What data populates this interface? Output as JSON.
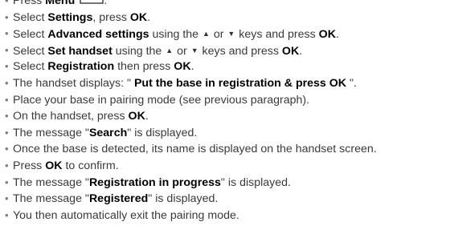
{
  "steps": [
    {
      "segments": [
        {
          "t": "Press ",
          "b": false
        },
        {
          "t": "Menu",
          "b": true
        }
      ],
      "menu_icon": true,
      "tail": "."
    },
    {
      "segments": [
        {
          "t": "Select ",
          "b": false
        },
        {
          "t": "Settings",
          "b": true
        },
        {
          "t": ", press ",
          "b": false
        },
        {
          "t": "OK",
          "b": true
        },
        {
          "t": ".",
          "b": false
        }
      ]
    },
    {
      "segments": [
        {
          "t": "Select ",
          "b": false
        },
        {
          "t": "Advanced settings",
          "b": true
        },
        {
          "t": " using the ",
          "b": false
        },
        {
          "icon": "up"
        },
        {
          "t": " or ",
          "b": false
        },
        {
          "icon": "down"
        },
        {
          "t": " keys and press ",
          "b": false
        },
        {
          "t": "OK",
          "b": true
        },
        {
          "t": ".",
          "b": false
        }
      ]
    },
    {
      "segments": [
        {
          "t": "Select ",
          "b": false
        },
        {
          "t": "Set handset",
          "b": true
        },
        {
          "t": " using the ",
          "b": false
        },
        {
          "icon": "up"
        },
        {
          "t": " or ",
          "b": false
        },
        {
          "icon": "down"
        },
        {
          "t": " keys and press ",
          "b": false
        },
        {
          "t": "OK",
          "b": true
        },
        {
          "t": ".",
          "b": false
        }
      ]
    },
    {
      "segments": [
        {
          "t": "Select ",
          "b": false
        },
        {
          "t": "Registration",
          "b": true
        },
        {
          "t": " then press ",
          "b": false
        },
        {
          "t": "OK",
          "b": true
        },
        {
          "t": ".",
          "b": false
        }
      ]
    },
    {
      "segments": [
        {
          "t": "The handset displays: \" ",
          "b": false
        },
        {
          "t": "Put the base in registration & press OK",
          "b": true
        },
        {
          "t": " \".",
          "b": false
        }
      ]
    },
    {
      "segments": [
        {
          "t": "Place your base in pairing mode (see previous paragraph).",
          "b": false
        }
      ]
    },
    {
      "segments": [
        {
          "t": "On the handset, press ",
          "b": false
        },
        {
          "t": "OK",
          "b": true
        },
        {
          "t": ".",
          "b": false
        }
      ]
    },
    {
      "segments": [
        {
          "t": "The message \"",
          "b": false
        },
        {
          "t": "Search",
          "b": true
        },
        {
          "t": "\" is displayed.",
          "b": false
        }
      ]
    },
    {
      "segments": [
        {
          "t": "Once the base is detected, its name is displayed on the handset screen.",
          "b": false
        }
      ]
    },
    {
      "segments": [
        {
          "t": "Press ",
          "b": false
        },
        {
          "t": "OK",
          "b": true
        },
        {
          "t": " to confirm.",
          "b": false
        }
      ]
    },
    {
      "segments": [
        {
          "t": "The message \"",
          "b": false
        },
        {
          "t": "Registration in progress",
          "b": true
        },
        {
          "t": "\" is displayed.",
          "b": false
        }
      ]
    },
    {
      "segments": [
        {
          "t": "The message \"",
          "b": false
        },
        {
          "t": "Registered",
          "b": true
        },
        {
          "t": "\" is displayed.",
          "b": false
        }
      ]
    },
    {
      "segments": [
        {
          "t": "You then automatically exit the pairing mode.",
          "b": false
        }
      ]
    }
  ],
  "bullet_glyph": "•",
  "icons": {
    "up": "up-arrow-key-icon",
    "down": "down-arrow-key-icon",
    "menu": "menu-key-icon"
  },
  "colors": {
    "text": "#3a3a3a",
    "bold_text": "#000000",
    "bullet": "#7a7a7a"
  }
}
